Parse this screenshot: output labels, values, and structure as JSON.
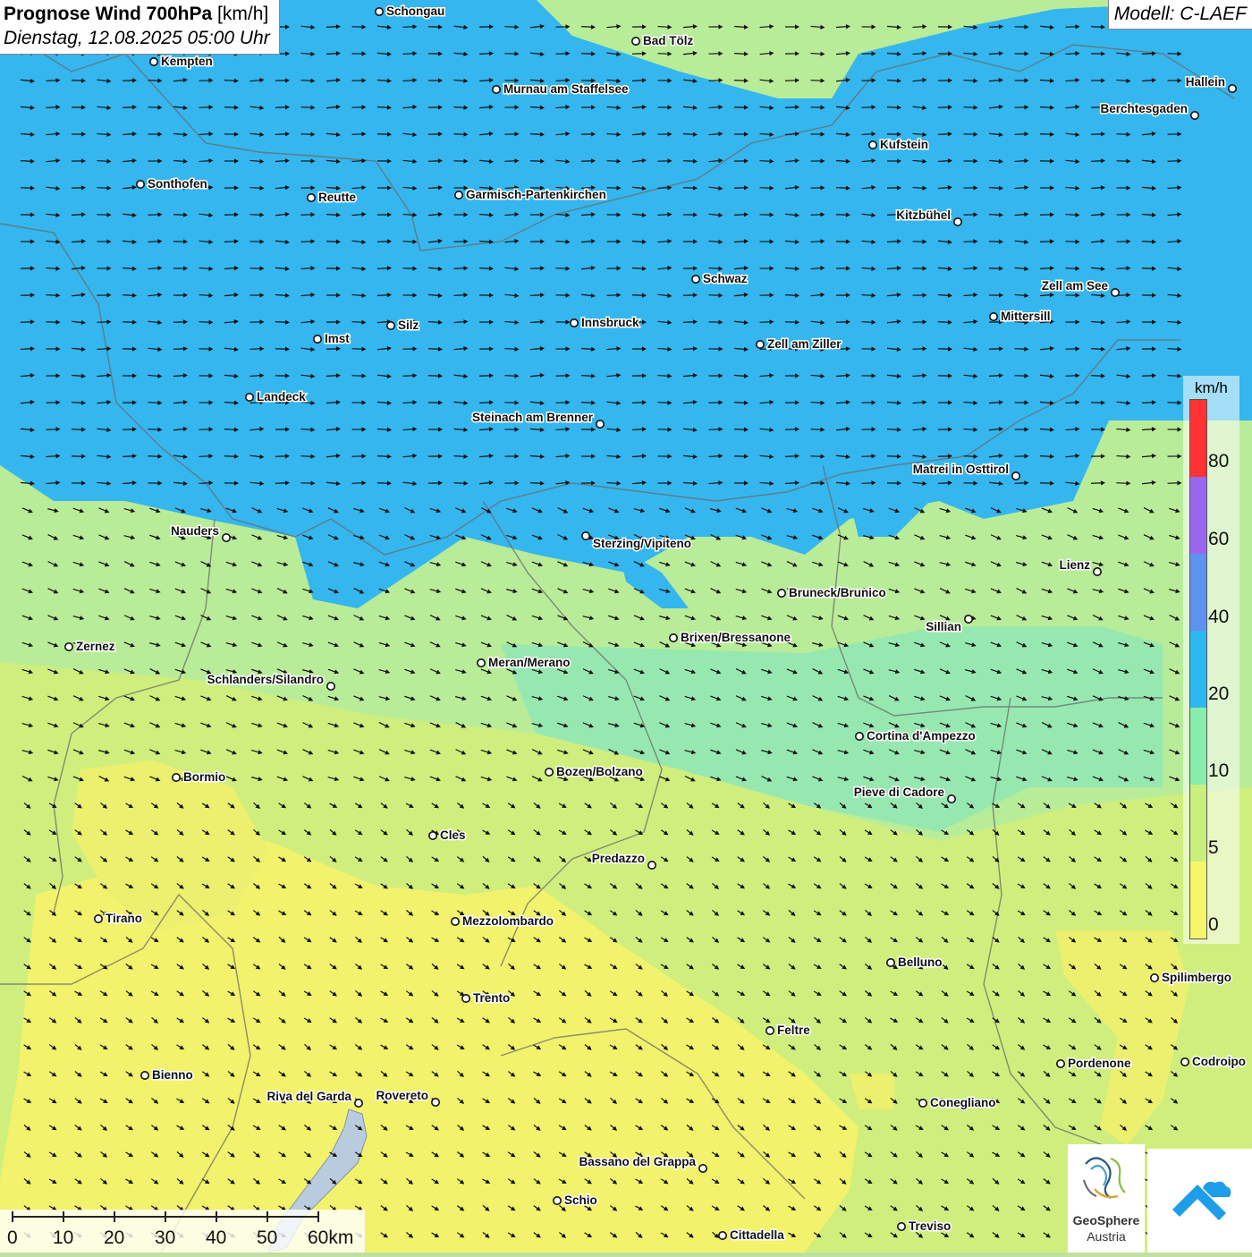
{
  "title": {
    "bold": "Prognose Wind 700hPa",
    "unit": "[km/h]",
    "datetime": "Dienstag, 12.08.2025 05:00 Uhr"
  },
  "model": "Modell: C-LAEF",
  "legend": {
    "unit": "km/h",
    "colors": [
      "#ff3333",
      "#9966ee",
      "#5f92ee",
      "#2cb8f0",
      "#88ecaa",
      "#c9f07a",
      "#f7f56a"
    ],
    "labels": [
      "80",
      "60",
      "40",
      "20",
      "10",
      "5",
      "0"
    ]
  },
  "scale_bar": {
    "labels": [
      "0",
      "10",
      "20",
      "30",
      "40",
      "50",
      "60km"
    ]
  },
  "logos": {
    "geosphere_line1": "GeoSphere",
    "geosphere_line2": "Austria"
  },
  "cities": [
    {
      "name": "Schongau"
    },
    {
      "name": "Bad Tölz"
    },
    {
      "name": "Kempten"
    },
    {
      "name": "Murnau am Staffelsee"
    },
    {
      "name": "Hallein"
    },
    {
      "name": "Berchtesgaden"
    },
    {
      "name": "Kufstein"
    },
    {
      "name": "Sonthofen"
    },
    {
      "name": "Reutte"
    },
    {
      "name": "Garmisch-Partenkirchen"
    },
    {
      "name": "Kitzbühel"
    },
    {
      "name": "Schwaz"
    },
    {
      "name": "Zell am See"
    },
    {
      "name": "Mittersill"
    },
    {
      "name": "Silz"
    },
    {
      "name": "Innsbruck"
    },
    {
      "name": "Imst"
    },
    {
      "name": "Zell am Ziller"
    },
    {
      "name": "Landeck"
    },
    {
      "name": "Steinach am Brenner"
    },
    {
      "name": "Matrei in Osttirol"
    },
    {
      "name": "Nauders"
    },
    {
      "name": "Sterzing/Vipiteno"
    },
    {
      "name": "Lienz"
    },
    {
      "name": "Bruneck/Brunico"
    },
    {
      "name": "Sillian"
    },
    {
      "name": "Brixen/Bressanone"
    },
    {
      "name": "Zernez"
    },
    {
      "name": "Meran/Merano"
    },
    {
      "name": "Schlanders/Silandro"
    },
    {
      "name": "Cortina d'Ampezzo"
    },
    {
      "name": "Bozen/Bolzano"
    },
    {
      "name": "Bormio"
    },
    {
      "name": "Pieve di Cadore"
    },
    {
      "name": "Cles"
    },
    {
      "name": "Predazzo"
    },
    {
      "name": "Tirano"
    },
    {
      "name": "Mezzolombardo"
    },
    {
      "name": "Belluno"
    },
    {
      "name": "Spilimbergo"
    },
    {
      "name": "Trento"
    },
    {
      "name": "Feltre"
    },
    {
      "name": "Pordenone"
    },
    {
      "name": "Codroipo"
    },
    {
      "name": "Bienno"
    },
    {
      "name": "Riva del Garda"
    },
    {
      "name": "Rovereto"
    },
    {
      "name": "Conegliano"
    },
    {
      "name": "Bassano del Grappa"
    },
    {
      "name": "Schio"
    },
    {
      "name": "Treviso"
    },
    {
      "name": "Cittadella"
    }
  ]
}
